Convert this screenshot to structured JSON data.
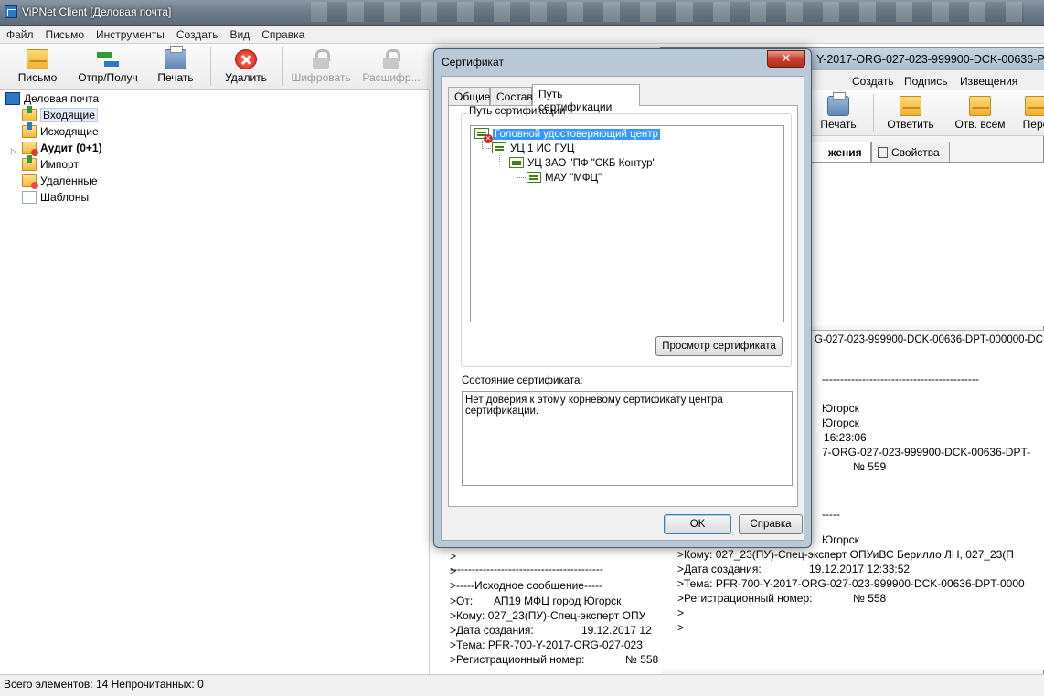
{
  "window": {
    "title": "ViPNet Client [Деловая почта]"
  },
  "menu": [
    "Файл",
    "Письмо",
    "Инструменты",
    "Создать",
    "Вид",
    "Справка"
  ],
  "toolbar": {
    "new_letter": "Письмо",
    "send_receive": "Отпр/Получ",
    "print": "Печать",
    "delete": "Удалить",
    "encrypt": "Шифровать",
    "decrypt": "Расшифр..."
  },
  "folders": {
    "root": "Деловая почта",
    "items": [
      {
        "label": "Входящие",
        "icon": "inbox-icon"
      },
      {
        "label": "Исходящие",
        "icon": "outbox-icon"
      },
      {
        "label": "Аудит (0+1)",
        "icon": "audit-icon"
      },
      {
        "label": "Импорт",
        "icon": "import-icon"
      },
      {
        "label": "Удаленные",
        "icon": "deleted-icon"
      },
      {
        "label": "Шаблоны",
        "icon": "templates-icon"
      }
    ]
  },
  "message_window": {
    "title_fragment": "Y-2017-ORG-027-023-999900-DCK-00636-P",
    "menu": [
      "Создать",
      "Подпись",
      "Извещения"
    ],
    "toolbar": {
      "print": "Печать",
      "reply": "Ответить",
      "reply_all": "Отв. всем",
      "forward": "Пере"
    },
    "tabs": {
      "attachments": "жения",
      "properties": "Свойства"
    },
    "subject_line": "G-027-023-999900-DCK-00636-DPT-000000-DCK-0",
    "block1": {
      "separator": "-------------------------------------------",
      "from_city": "Югорск",
      "to_city": "Югорск",
      "time": "16:23:06",
      "subject": "7-ORG-027-023-999900-DCK-00636-DPT-",
      "reg": "№ 559"
    },
    "block2": {
      "separator": "-----",
      "from_city": "Югорск",
      "to": ">Кому:  027_23(ПУ)-Спец-эксперт ОПУиВС Берилло ЛН, 027_23(П",
      "date_label": ">Дата создания:",
      "date_value": "19.12.2017 12:33:52",
      "subject": ">Тема:  PFR-700-Y-2017-ORG-027-023-999900-DCK-00636-DPT-0000",
      "reg_label": ">Регистрационный номер:",
      "reg_value": "№ 558",
      "q1": ">",
      "q2": ">"
    }
  },
  "preview_pane": {
    "q0": ">",
    "separator": "------------------------------------------",
    "q1": ">",
    "orig": ">-----Исходное сообщение-----",
    "from_label": ">От:",
    "from_value": "АП19 МФЦ город Югорск",
    "to": ">Кому:  027_23(ПУ)-Спец-эксперт ОПУ",
    "date_label": ">Дата создания:",
    "date_value": "19.12.2017 12",
    "subject": ">Тема:  PFR-700-Y-2017-ORG-027-023",
    "reg_label": ">Регистрационный номер:",
    "reg_value": "№ 558"
  },
  "dialog": {
    "title": "Сертификат",
    "close": "✕",
    "tabs": [
      "Общие",
      "Состав",
      "Путь сертификации"
    ],
    "active_tab": 2,
    "path_group_label": "Путь сертификации",
    "chain": [
      {
        "name": "Головной удостоверяющий центр",
        "status": "untrusted"
      },
      {
        "name": "УЦ 1 ИС ГУЦ",
        "status": "ok"
      },
      {
        "name": "УЦ ЗАО \"ПФ \"СКБ Контур\"",
        "status": "ok"
      },
      {
        "name": "МАУ \"МФЦ\"",
        "status": "ok"
      }
    ],
    "view_cert_button": "Просмотр сертификата",
    "status_label": "Состояние сертификата:",
    "status_text": "Нет доверия к этому корневому сертификату центра сертификации.",
    "ok_button": "OK",
    "help_button": "Справка"
  },
  "status_bar": {
    "text": "Всего элементов: 14  Непрочитанных: 0"
  },
  "colors": {
    "selection": "#3399ff",
    "error": "#d42516"
  }
}
